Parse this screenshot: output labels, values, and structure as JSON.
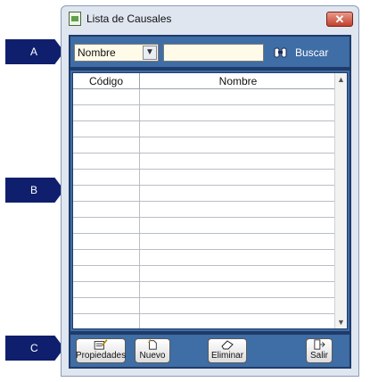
{
  "callouts": [
    "A",
    "B",
    "C"
  ],
  "window": {
    "title": "Lista de Causales",
    "close_label": "✕"
  },
  "search": {
    "field_selected": "Nombre",
    "query_value": "",
    "search_label": "Buscar"
  },
  "table": {
    "columns": [
      "Código",
      "Nombre"
    ],
    "rows": [
      [
        "",
        ""
      ],
      [
        "",
        ""
      ],
      [
        "",
        ""
      ],
      [
        "",
        ""
      ],
      [
        "",
        ""
      ],
      [
        "",
        ""
      ],
      [
        "",
        ""
      ],
      [
        "",
        ""
      ],
      [
        "",
        ""
      ],
      [
        "",
        ""
      ],
      [
        "",
        ""
      ],
      [
        "",
        ""
      ],
      [
        "",
        ""
      ],
      [
        "",
        ""
      ],
      [
        "",
        ""
      ]
    ]
  },
  "buttons": {
    "properties": "Propiedades",
    "new": "Nuevo",
    "delete": "Eliminar",
    "exit": "Salir"
  },
  "icons": {
    "app": "form-icon",
    "search": "binoculars-icon",
    "properties": "edit-form-icon",
    "new": "new-document-icon",
    "delete": "eraser-icon",
    "exit": "exit-door-icon"
  },
  "colors": {
    "panel": "#3f6da5",
    "callout": "#0f1f6e",
    "input_bg": "#fffbe8",
    "close": "#c2412c"
  }
}
